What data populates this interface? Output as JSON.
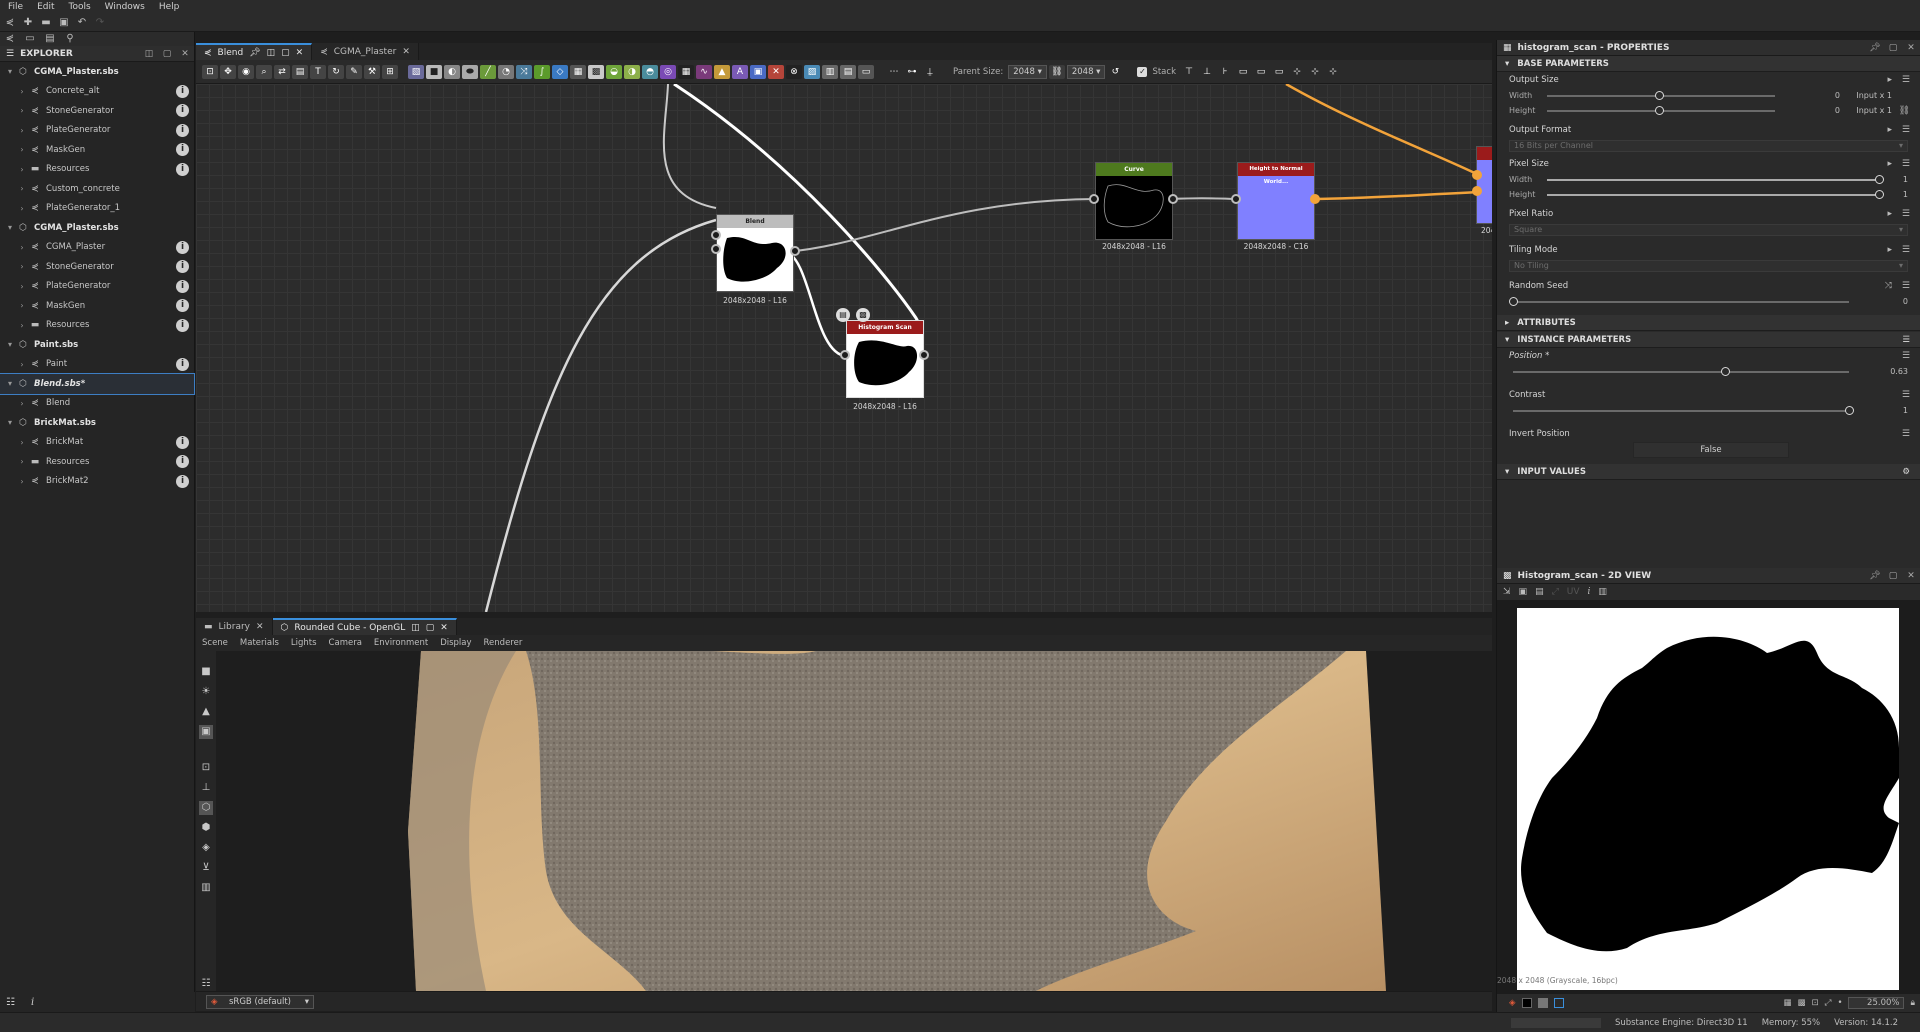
{
  "menu": [
    "File",
    "Edit",
    "Tools",
    "Windows",
    "Help"
  ],
  "explorer": {
    "title": "EXPLORER",
    "items": [
      {
        "label": "CGMA_Plaster.sbs",
        "type": "package",
        "level": 0,
        "info": false
      },
      {
        "label": "Concrete_alt",
        "type": "graph",
        "level": 1,
        "info": true
      },
      {
        "label": "StoneGenerator",
        "type": "graph",
        "level": 1,
        "info": true
      },
      {
        "label": "PlateGenerator",
        "type": "graph",
        "level": 1,
        "info": true
      },
      {
        "label": "MaskGen",
        "type": "graph",
        "level": 1,
        "info": true
      },
      {
        "label": "Resources",
        "type": "folder",
        "level": 1,
        "info": true
      },
      {
        "label": "Custom_concrete",
        "type": "graph",
        "level": 1,
        "info": false
      },
      {
        "label": "PlateGenerator_1",
        "type": "graph",
        "level": 1,
        "info": false
      },
      {
        "label": "CGMA_Plaster.sbs",
        "type": "package",
        "level": 0,
        "info": false
      },
      {
        "label": "CGMA_Plaster",
        "type": "graph",
        "level": 1,
        "info": true
      },
      {
        "label": "StoneGenerator",
        "type": "graph",
        "level": 1,
        "info": true
      },
      {
        "label": "PlateGenerator",
        "type": "graph",
        "level": 1,
        "info": true
      },
      {
        "label": "MaskGen",
        "type": "graph",
        "level": 1,
        "info": true
      },
      {
        "label": "Resources",
        "type": "folder",
        "level": 1,
        "info": true
      },
      {
        "label": "Paint.sbs",
        "type": "package",
        "level": 0,
        "info": false
      },
      {
        "label": "Paint",
        "type": "graph",
        "level": 1,
        "info": true
      },
      {
        "label": "Blend.sbs*",
        "type": "package",
        "level": 0,
        "info": false,
        "selected": true
      },
      {
        "label": "Blend",
        "type": "graph",
        "level": 1,
        "info": false
      },
      {
        "label": "BrickMat.sbs",
        "type": "package",
        "level": 0,
        "info": false
      },
      {
        "label": "BrickMat",
        "type": "graph",
        "level": 1,
        "info": true
      },
      {
        "label": "Resources",
        "type": "folder",
        "level": 1,
        "info": true
      },
      {
        "label": "BrickMat2",
        "type": "graph",
        "level": 1,
        "info": true
      }
    ]
  },
  "graph": {
    "tabs": [
      {
        "label": "Blend",
        "active": true
      },
      {
        "label": "CGMA_Plaster",
        "active": false
      }
    ],
    "toolbar": {
      "parent_size_label": "Parent Size:",
      "parent_size_value": "2048",
      "size_value": "2048",
      "stack_label": "Stack"
    },
    "nodes": [
      {
        "id": "blend",
        "title": "Blend",
        "caption": "2048x2048 - L16",
        "head_color": "#bdbdbd"
      },
      {
        "id": "histogram",
        "title": "Histogram Scan",
        "caption": "2048x2048 - L16",
        "head_color": "#9b1b1b"
      },
      {
        "id": "curve",
        "title": "Curve",
        "caption": "2048x2048 - L16",
        "head_color": "#4e7a1e"
      },
      {
        "id": "h2n",
        "title": "Height to Normal World...",
        "caption": "2048x2048 - C16",
        "head_color": "#9b1b1b"
      },
      {
        "id": "partial",
        "title": "",
        "caption": "204",
        "head_color": "#9b1b1b"
      }
    ]
  },
  "viewport": {
    "tabs": [
      {
        "label": "Library",
        "active": false
      },
      {
        "label": "Rounded Cube - OpenGL",
        "active": true
      }
    ],
    "menu": [
      "Scene",
      "Materials",
      "Lights",
      "Camera",
      "Environment",
      "Display",
      "Renderer"
    ],
    "colorspace": "sRGB (default)"
  },
  "properties": {
    "title": "histogram_scan - PROPERTIES",
    "base_section": "BASE PARAMETERS",
    "output_size": {
      "label": "Output Size",
      "width_label": "Width",
      "height_label": "Height",
      "width_value": "0",
      "height_value": "0",
      "width_mode": "Input x 1",
      "height_mode": "Input x 1"
    },
    "output_format": {
      "label": "Output Format",
      "value": "16 Bits per Channel"
    },
    "pixel_size": {
      "label": "Pixel Size",
      "width_label": "Width",
      "height_label": "Height",
      "width_value": "1",
      "height_value": "1"
    },
    "pixel_ratio": {
      "label": "Pixel Ratio",
      "value": "Square"
    },
    "tiling_mode": {
      "label": "Tiling Mode",
      "value": "No Tiling"
    },
    "random_seed": {
      "label": "Random Seed",
      "value": "0"
    },
    "attributes_section": "ATTRIBUTES",
    "instance_section": "INSTANCE PARAMETERS",
    "position": {
      "label": "Position *",
      "value": "0.63",
      "fraction": 0.63
    },
    "contrast": {
      "label": "Contrast",
      "value": "1",
      "fraction": 1.0
    },
    "invert_position": {
      "label": "Invert Position",
      "value": "False"
    },
    "input_values_section": "INPUT VALUES"
  },
  "view2d": {
    "title": "Histogram_scan - 2D VIEW",
    "uv_label": "UV",
    "info": "2048 x 2048 (Grayscale, 16bpc)",
    "zoom": "25.00%"
  },
  "status": {
    "engine": "Substance Engine: Direct3D 11",
    "memory": "Memory: 55%",
    "version": "Version: 14.1.2"
  },
  "colors": {
    "accent": "#3a8fdc",
    "orange_link": "#f2a33a",
    "normal_map": "#8080ff"
  }
}
